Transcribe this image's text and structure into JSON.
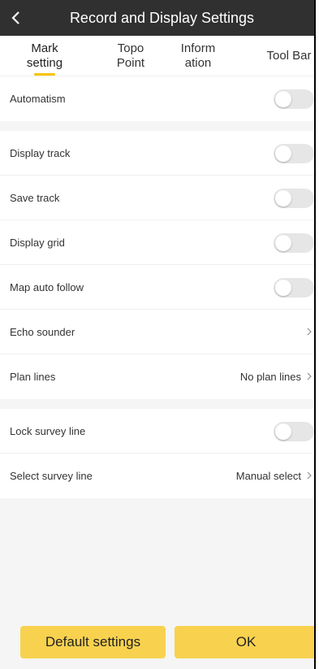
{
  "header": {
    "title": "Record and Display Settings",
    "back_icon": "chevron-left-icon"
  },
  "tabs": [
    {
      "line1": "Mark",
      "line2": "setting",
      "active": true
    },
    {
      "line1": "Topo",
      "line2": "Point",
      "active": false
    },
    {
      "line1": "Inform",
      "line2": "ation",
      "active": false
    },
    {
      "line1": "Tool Bar",
      "line2": "",
      "active": false
    }
  ],
  "accent_color": "#f5c400",
  "button_color": "#f8d24f",
  "settings": {
    "automatism": {
      "label": "Automatism",
      "on": false
    },
    "display_track": {
      "label": "Display track",
      "on": false
    },
    "save_track": {
      "label": "Save track",
      "on": false
    },
    "display_grid": {
      "label": "Display grid",
      "on": false
    },
    "map_auto_follow": {
      "label": "Map auto follow",
      "on": false
    },
    "echo_sounder": {
      "label": "Echo sounder"
    },
    "plan_lines": {
      "label": "Plan lines",
      "value": "No plan lines"
    },
    "lock_survey_line": {
      "label": "Lock survey line",
      "on": false
    },
    "select_survey_line": {
      "label": "Select survey line",
      "value": "Manual select"
    }
  },
  "footer": {
    "default_label": "Default settings",
    "ok_label": "OK"
  }
}
